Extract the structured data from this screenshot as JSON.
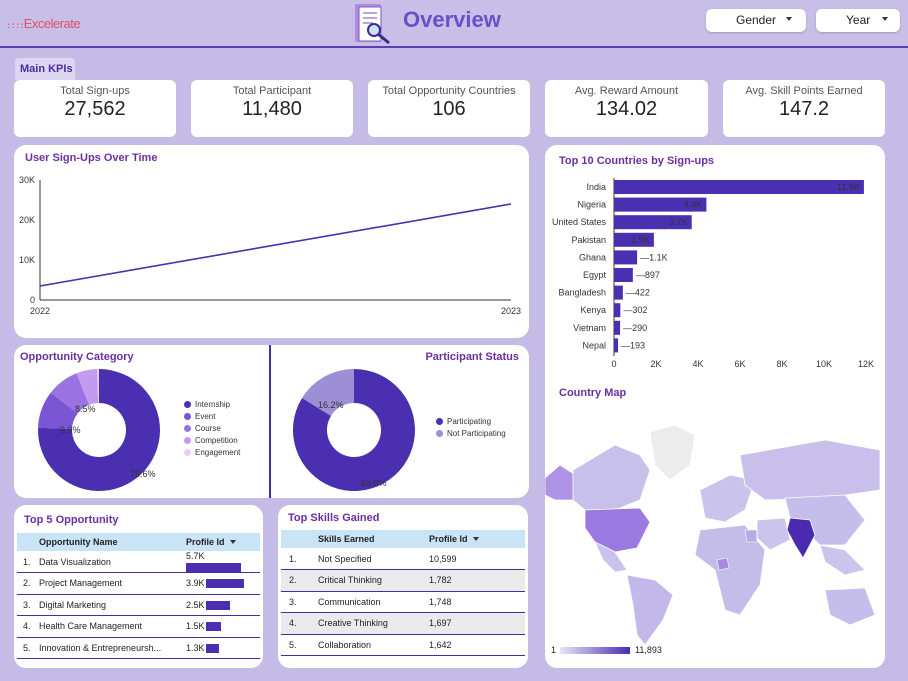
{
  "header": {
    "logo": "Excelerate",
    "title": "Overview",
    "filters": [
      {
        "label": "Gender"
      },
      {
        "label": "Year"
      }
    ]
  },
  "kpi_tab": "Main KPIs",
  "kpis": [
    {
      "label": "Total Sign-ups",
      "value": "27,562"
    },
    {
      "label": "Total Participant",
      "value": "11,480"
    },
    {
      "label": "Total Opportunity Countries",
      "value": "106"
    },
    {
      "label": "Avg. Reward Amount",
      "value": "134.02"
    },
    {
      "label": "Avg. Skill Points Earned",
      "value": "147.2"
    }
  ],
  "signups_chart": {
    "title": "User Sign-Ups Over Time",
    "chart_data": {
      "type": "line",
      "x": [
        "2022",
        "2023"
      ],
      "series": [
        {
          "values": [
            3500,
            24000
          ]
        }
      ],
      "yticks": [
        "0",
        "10K",
        "20K",
        "30K"
      ],
      "ylim": [
        0,
        30000
      ]
    }
  },
  "opportunity_category": {
    "title": "Opportunity Category",
    "chart_data": {
      "type": "pie",
      "labels": [
        "Internship",
        "Event",
        "Course",
        "Competition",
        "Engagement"
      ],
      "values": [
        75.6,
        9.9,
        8.5,
        5.5,
        0.5
      ],
      "data_labels": [
        "75.6%",
        "9.9%",
        "8.5%"
      ],
      "colors": [
        "#4a2fb0",
        "#7a55d4",
        "#9b73e0",
        "#c49af0",
        "#e8cdf8"
      ]
    }
  },
  "participant_status": {
    "title": "Participant Status",
    "chart_data": {
      "type": "pie",
      "labels": [
        "Participating",
        "Not Participating"
      ],
      "values": [
        83.8,
        16.2
      ],
      "data_labels": [
        "83.8%",
        "16.2%"
      ],
      "colors": [
        "#4a2fb0",
        "#9d8fd6"
      ]
    }
  },
  "top_countries": {
    "title": "Top 10 Countries by Sign-ups",
    "chart_data": {
      "type": "bar",
      "orientation": "horizontal",
      "categories": [
        "India",
        "Nigeria",
        "United States",
        "Pakistan",
        "Ghana",
        "Egypt",
        "Bangladesh",
        "Kenya",
        "Vietnam",
        "Nepal"
      ],
      "values": [
        11900,
        4400,
        3700,
        1900,
        1100,
        897,
        422,
        302,
        290,
        193
      ],
      "data_labels": [
        "11.9K",
        "4.4K",
        "3.7K",
        "1.9K",
        "1.1K",
        "897",
        "422",
        "302",
        "290",
        "193"
      ],
      "xticks": [
        "0",
        "2K",
        "4K",
        "6K",
        "8K",
        "10K",
        "12K"
      ],
      "xlim": [
        0,
        12000
      ]
    }
  },
  "country_map": {
    "title": "Country Map",
    "scale_min": "1",
    "scale_max": "11,893"
  },
  "top_opportunity": {
    "title": "Top 5 Opportunity",
    "columns": [
      "Opportunity Name",
      "Profile Id"
    ],
    "rows": [
      {
        "rank": "1.",
        "name": "Data Visualization",
        "value": "5.7K",
        "fraction": 1.0
      },
      {
        "rank": "2.",
        "name": "Project Management",
        "value": "3.9K",
        "fraction": 0.684
      },
      {
        "rank": "3.",
        "name": "Digital Marketing",
        "value": "2.5K",
        "fraction": 0.439
      },
      {
        "rank": "4.",
        "name": "Health Care Management",
        "value": "1.5K",
        "fraction": 0.263
      },
      {
        "rank": "5.",
        "name": "Innovation & Entrepreneursh...",
        "value": "1.3K",
        "fraction": 0.228
      }
    ]
  },
  "top_skills": {
    "title": "Top Skills Gained",
    "columns": [
      "Skills Earned",
      "Profile Id"
    ],
    "rows": [
      {
        "rank": "1.",
        "name": "Not Specified",
        "value": "10,599"
      },
      {
        "rank": "2.",
        "name": "Critical Thinking",
        "value": "1,782"
      },
      {
        "rank": "3.",
        "name": "Communication",
        "value": "1,748"
      },
      {
        "rank": "4.",
        "name": "Creative Thinking",
        "value": "1,697"
      },
      {
        "rank": "5.",
        "name": "Collaboration",
        "value": "1,642"
      }
    ]
  }
}
